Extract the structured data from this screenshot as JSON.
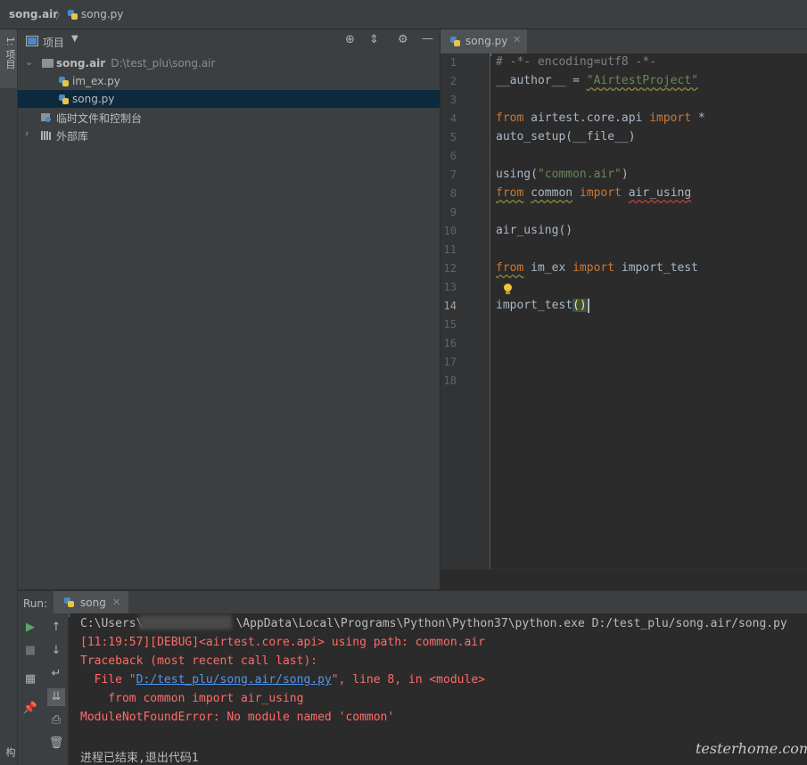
{
  "breadcrumb": {
    "project": "song.air",
    "file": "song.py"
  },
  "left_strip": {
    "project_tab": "1: 项目",
    "structure_tab": "结构"
  },
  "project_panel": {
    "title": "项目",
    "tree": [
      {
        "label": "song.air",
        "sub": "D:\\test_plu\\song.air"
      },
      {
        "label": "im_ex.py"
      },
      {
        "label": "song.py"
      },
      {
        "label": "临时文件和控制台"
      },
      {
        "label": "外部库"
      }
    ]
  },
  "editor": {
    "tab": "song.py",
    "line_numbers": [
      "1",
      "2",
      "3",
      "4",
      "5",
      "6",
      "7",
      "8",
      "9",
      "10",
      "11",
      "12",
      "13",
      "14",
      "15",
      "16",
      "17",
      "18"
    ],
    "current_line": "14",
    "code": {
      "l1": "# -*- encoding=utf8 -*-",
      "l2_a": "__author__ = ",
      "l2_str": "\"AirtestProject\"",
      "l4_kw1": "from",
      "l4_mid": " airtest.core.api ",
      "l4_kw2": "import",
      "l4_end": " *",
      "l5": "auto_setup(__file__)",
      "l7_a": "using(",
      "l7_str": "\"common.air\"",
      "l7_b": ")",
      "l8_kw1": "from",
      "l8_mod": "common",
      "l8_kw2": "import",
      "l8_name": "air_using",
      "l10": "air_using()",
      "l12_kw1": "from",
      "l12_mod": " im_ex ",
      "l12_kw2": "import",
      "l12_name": " import_test",
      "l14_a": "import_test",
      "l14_paren": "()"
    }
  },
  "run": {
    "label": "Run:",
    "tab": "song",
    "console": {
      "line1_a": "C:\\Users\\",
      "line1_b": "\\AppData\\Local\\Programs\\Python\\Python37\\python.exe D:/test_plu/song.air/song.py",
      "line2": "[11:19:57][DEBUG]<airtest.core.api> using path: common.air",
      "line3": "Traceback (most recent call last):",
      "line4_a": "  File \"",
      "line4_link": "D:/test_plu/song.air/song.py",
      "line4_b": "\", line 8, in <module>",
      "line5": "    from common import air_using",
      "line6": "ModuleNotFoundError: No module named 'common'",
      "line7": "进程已结束,退出代码1"
    }
  },
  "watermark": "testerhome.com"
}
